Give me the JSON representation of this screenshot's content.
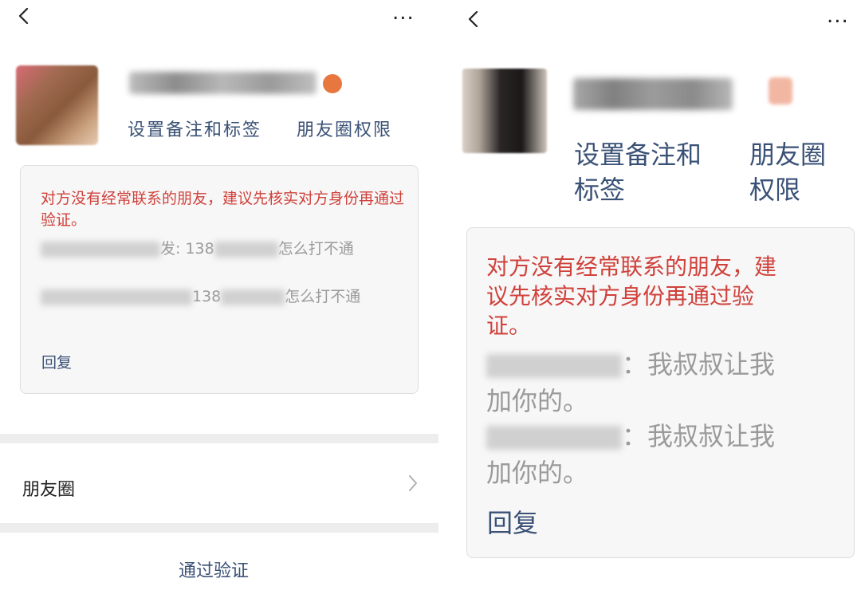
{
  "left": {
    "back": "<",
    "more": "...",
    "set_remark": "设置备注和标签",
    "moments_permission": "朋友圈权限",
    "warning": "对方没有经常联系的朋友，建议先核实对方身份再通过验证。",
    "messages": [
      {
        "prefix": "发: 138",
        "suffix": "怎么打不通"
      },
      {
        "prefix": "138",
        "suffix": "怎么打不通"
      }
    ],
    "reply": "回复",
    "moments": "朋友圈",
    "verify": "通过验证"
  },
  "right": {
    "back": "<",
    "more": "...",
    "set_remark_line1": "设置备注和",
    "set_remark_line2": "标签",
    "moments_perm_line1": "朋友圈",
    "moments_perm_line2": "权限",
    "warning_line1": "对方没有经常联系的朋友，建",
    "warning_line2": "议先核实对方身份再通过验",
    "warning_line3": "证。",
    "messages": [
      {
        "line1": "：我叔叔让我",
        "line2": "加你的。"
      },
      {
        "line1": "：我叔叔让我",
        "line2": "加你的。"
      }
    ],
    "reply": "回复"
  },
  "colors": {
    "warning": "#d0413b",
    "link": "#3a5176",
    "muted": "#9a9a9a",
    "card_bg": "#f7f7f7",
    "section_bg": "#ededed"
  }
}
